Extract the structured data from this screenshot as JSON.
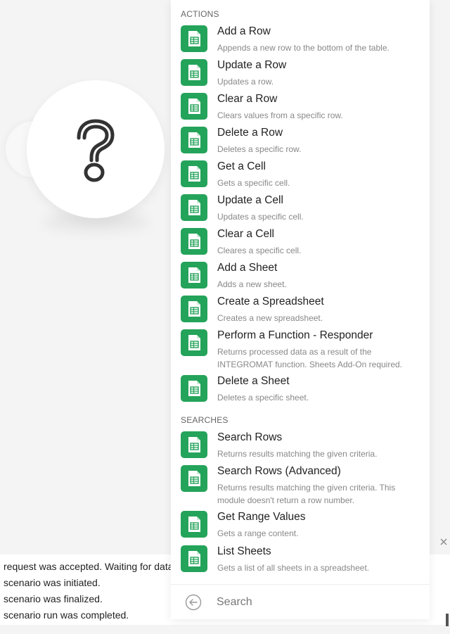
{
  "dropdown": {
    "actions_header": "ACTIONS",
    "searches_header": "SEARCHES",
    "actions": [
      {
        "title": "Add a Row",
        "desc": "Appends a new row to the bottom of the table."
      },
      {
        "title": "Update a Row",
        "desc": "Updates a row."
      },
      {
        "title": "Clear a Row",
        "desc": "Clears values from a specific row."
      },
      {
        "title": "Delete a Row",
        "desc": "Deletes a specific row."
      },
      {
        "title": "Get a Cell",
        "desc": "Gets a specific cell."
      },
      {
        "title": "Update a Cell",
        "desc": "Updates a specific cell."
      },
      {
        "title": "Clear a Cell",
        "desc": "Cleares a specific cell."
      },
      {
        "title": "Add a Sheet",
        "desc": "Adds a new sheet."
      },
      {
        "title": "Create a Spreadsheet",
        "desc": "Creates a new spreadsheet."
      },
      {
        "title": "Perform a Function - Responder",
        "desc": "Returns processed data as a result of the INTEGROMAT function. Sheets Add-On required."
      },
      {
        "title": "Delete a Sheet",
        "desc": "Deletes a specific sheet."
      }
    ],
    "searches": [
      {
        "title": "Search Rows",
        "desc": "Returns results matching the given criteria."
      },
      {
        "title": "Search Rows (Advanced)",
        "desc": "Returns results matching the given criteria. This module doesn't return a row number."
      },
      {
        "title": "Get Range Values",
        "desc": "Gets a range content."
      },
      {
        "title": "List Sheets",
        "desc": "Gets a list of all sheets in a spreadsheet."
      }
    ],
    "search_placeholder": "Search"
  },
  "log": {
    "lines": [
      "request was accepted. Waiting for data.",
      "scenario was initiated.",
      "scenario was finalized.",
      "scenario run was completed."
    ]
  },
  "icons": {
    "module": "question-mark-icon",
    "app": "google-sheets-icon",
    "back": "back-arrow-icon",
    "close": "close-icon"
  },
  "colors": {
    "sheets_green": "#24a35a",
    "background": "#f4f4f5"
  }
}
